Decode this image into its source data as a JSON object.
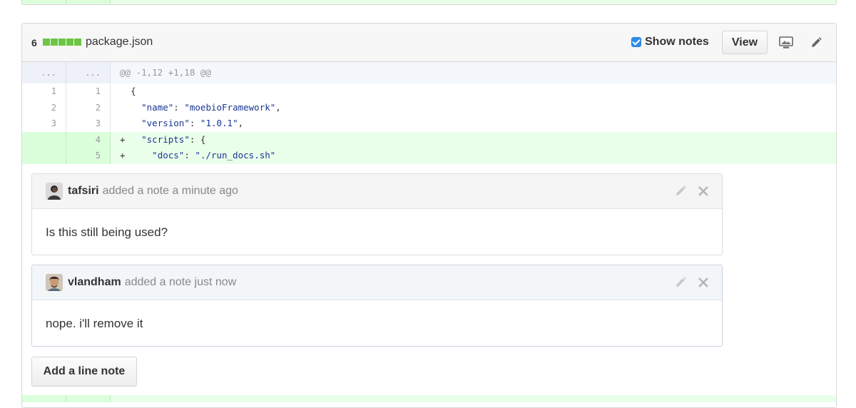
{
  "file": {
    "diffstat_count": "6",
    "diffstat_blocks": 5,
    "diffstat_color": "#6cc644",
    "name": "package.json",
    "show_notes_label": "Show notes",
    "show_notes_checked": true,
    "view_label": "View",
    "display_icon": "display-icon",
    "edit_icon": "pencil-icon"
  },
  "diff": {
    "hunk": {
      "old": "...",
      "new": "...",
      "text": "@@ -1,12 +1,18 @@"
    },
    "lines": [
      {
        "old": "1",
        "new": "1",
        "marker": " ",
        "text": "{",
        "type": "context"
      },
      {
        "old": "2",
        "new": "2",
        "marker": " ",
        "text": "  \"name\": \"moebioFramework\",",
        "type": "context"
      },
      {
        "old": "3",
        "new": "3",
        "marker": " ",
        "text": "  \"version\": \"1.0.1\",",
        "type": "context"
      },
      {
        "old": "",
        "new": "4",
        "marker": "+",
        "text": "  \"scripts\": {",
        "type": "add"
      },
      {
        "old": "",
        "new": "5",
        "marker": "+",
        "text": "    \"docs\": \"./run_docs.sh\"",
        "type": "add"
      }
    ]
  },
  "notes": [
    {
      "author": "tafsiri",
      "meta": "added a note a minute ago",
      "body": "Is this still being used?"
    },
    {
      "author": "vlandham",
      "meta": "added a note just now",
      "body": "nope. i'll remove it"
    }
  ],
  "add_note_label": "Add a line note",
  "colors": {
    "add_bg": "#eaffea",
    "add_gutter": "#dbffdb",
    "hunk_bg": "#f4f7fb",
    "string": "#183691",
    "checkbox": "#2f8ce8"
  }
}
